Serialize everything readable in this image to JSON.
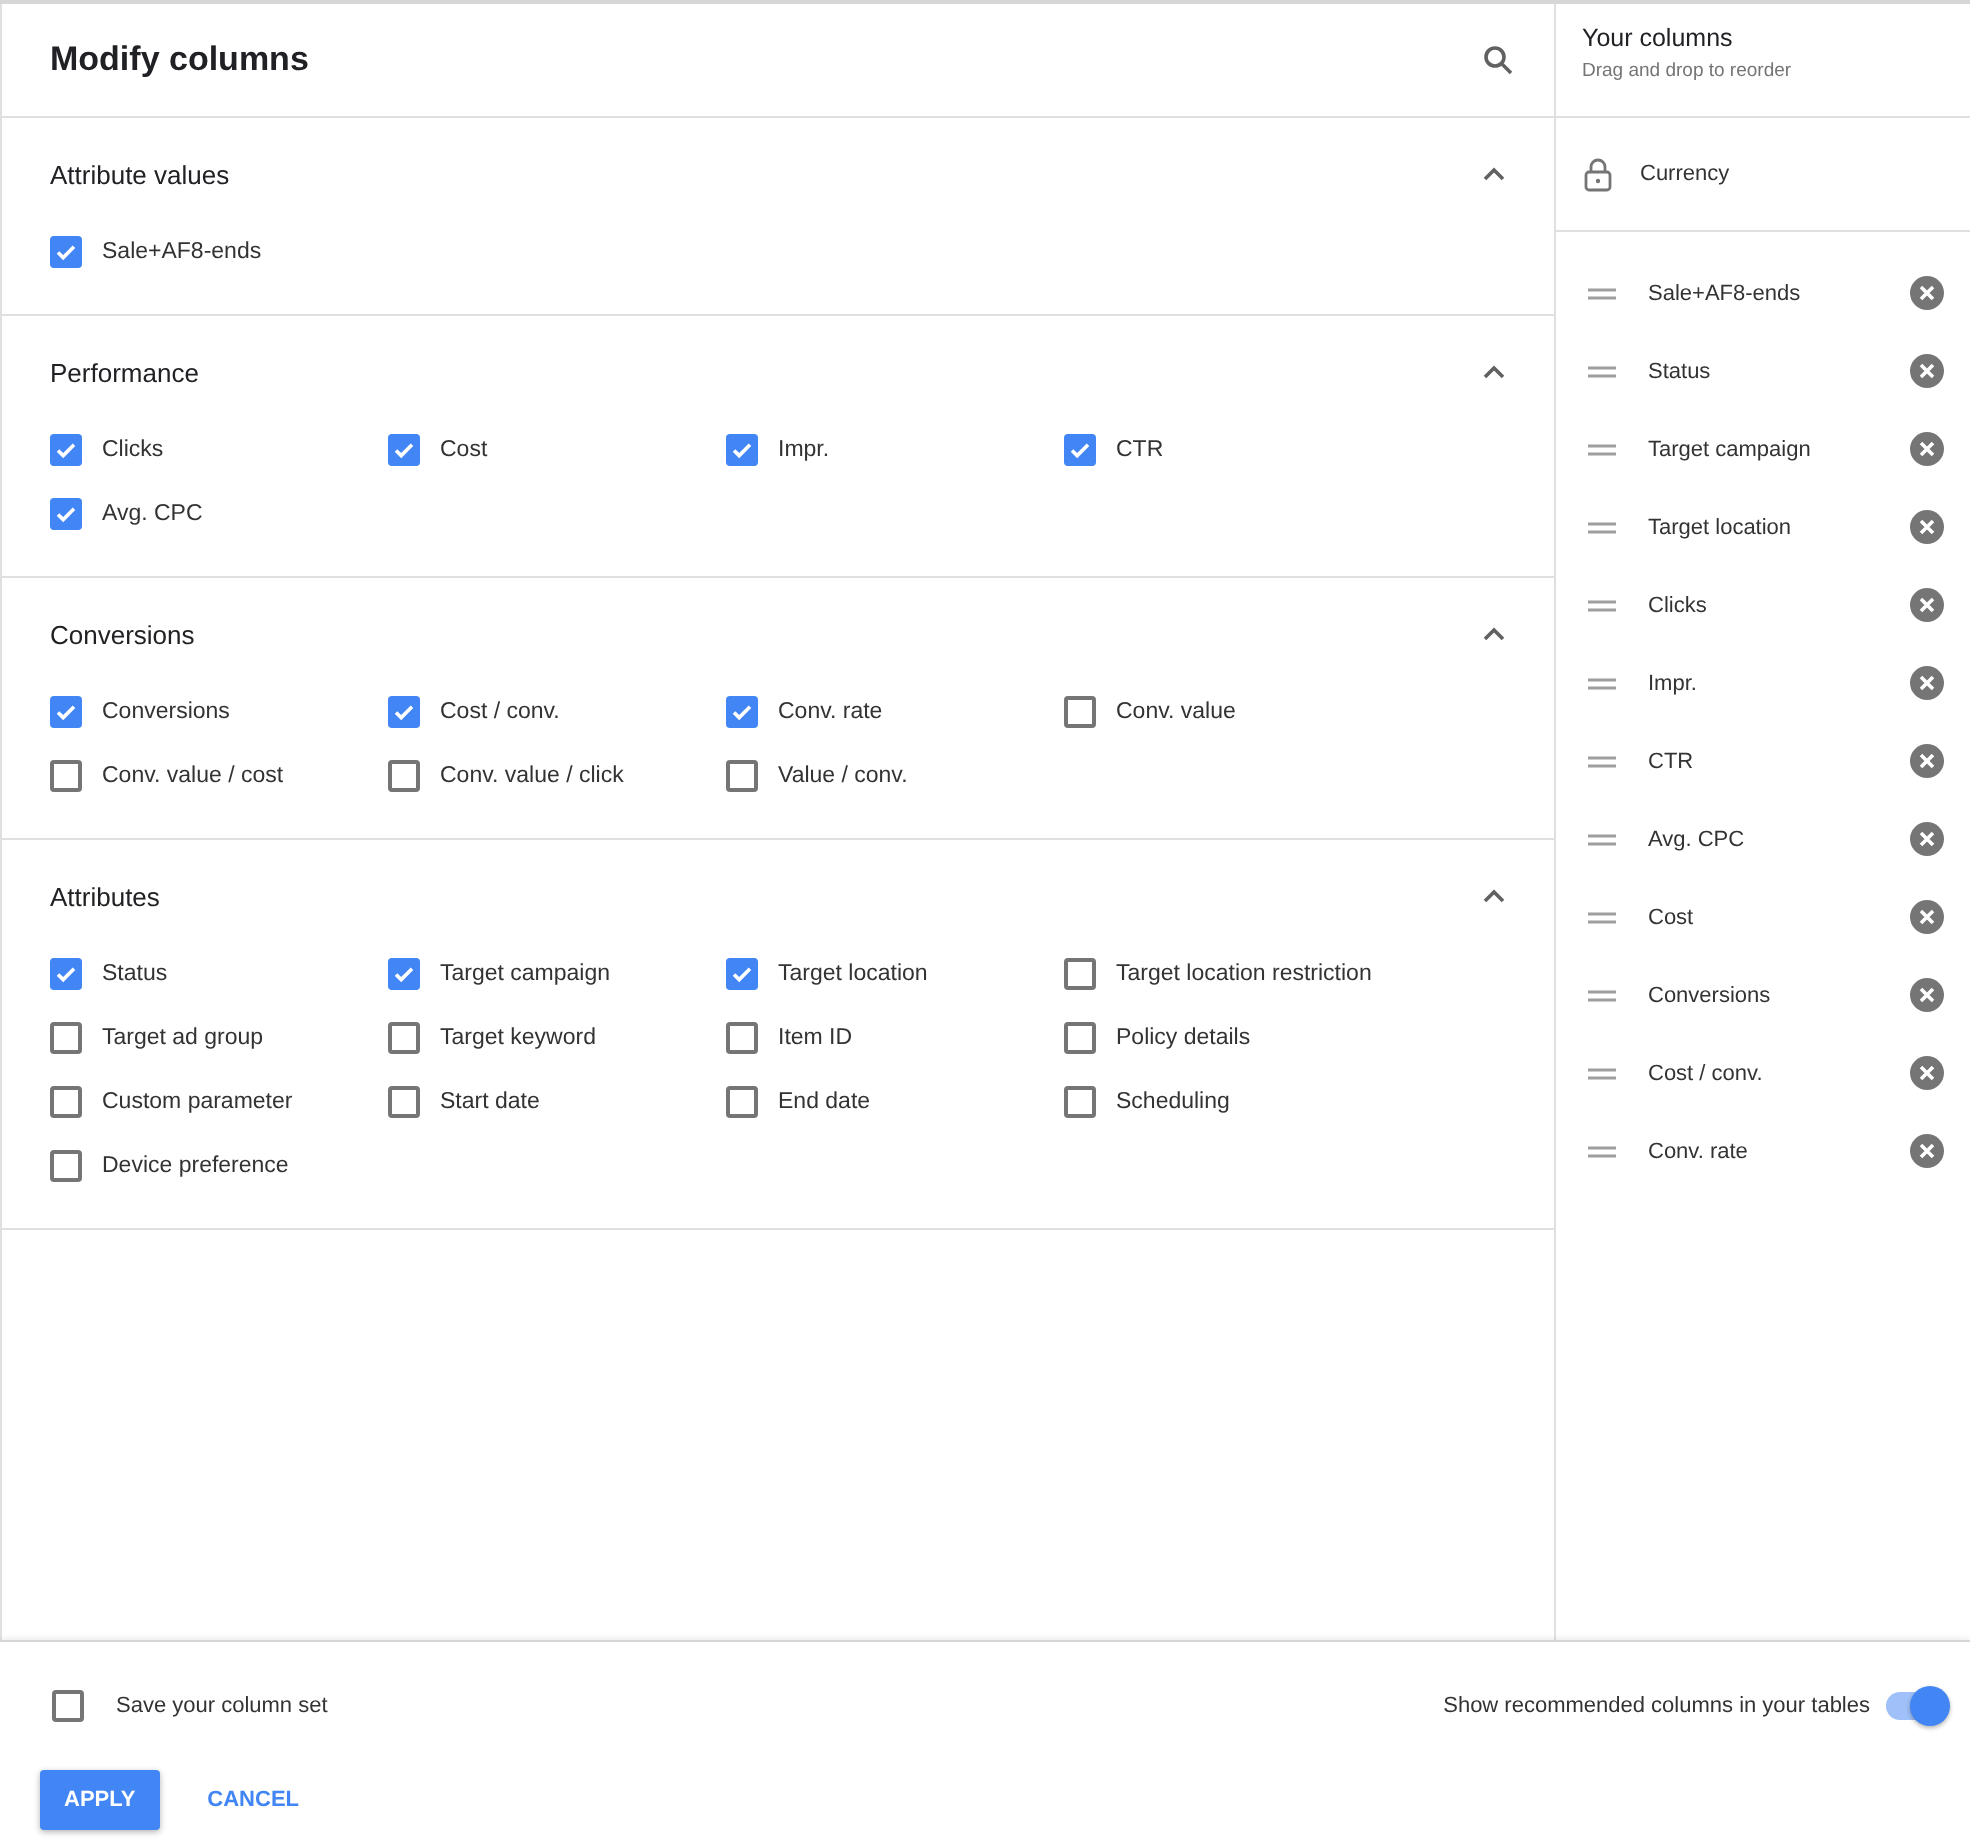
{
  "dialog": {
    "title": "Modify columns"
  },
  "sections": [
    {
      "title": "Attribute values",
      "expanded": true,
      "options": [
        {
          "label": "Sale+AF8-ends",
          "checked": true
        }
      ]
    },
    {
      "title": "Performance",
      "expanded": true,
      "options": [
        {
          "label": "Clicks",
          "checked": true
        },
        {
          "label": "Cost",
          "checked": true
        },
        {
          "label": "Impr.",
          "checked": true
        },
        {
          "label": "CTR",
          "checked": true
        },
        {
          "label": "Avg. CPC",
          "checked": true
        }
      ]
    },
    {
      "title": "Conversions",
      "expanded": true,
      "options": [
        {
          "label": "Conversions",
          "checked": true
        },
        {
          "label": "Cost / conv.",
          "checked": true
        },
        {
          "label": "Conv. rate",
          "checked": true
        },
        {
          "label": "Conv. value",
          "checked": false
        },
        {
          "label": "Conv. value / cost",
          "checked": false
        },
        {
          "label": "Conv. value / click",
          "checked": false
        },
        {
          "label": "Value / conv.",
          "checked": false
        }
      ]
    },
    {
      "title": "Attributes",
      "expanded": true,
      "options": [
        {
          "label": "Status",
          "checked": true
        },
        {
          "label": "Target campaign",
          "checked": true
        },
        {
          "label": "Target location",
          "checked": true
        },
        {
          "label": "Target location restriction",
          "checked": false
        },
        {
          "label": "Target ad group",
          "checked": false
        },
        {
          "label": "Target keyword",
          "checked": false
        },
        {
          "label": "Item ID",
          "checked": false
        },
        {
          "label": "Policy details",
          "checked": false
        },
        {
          "label": "Custom parameter",
          "checked": false
        },
        {
          "label": "Start date",
          "checked": false
        },
        {
          "label": "End date",
          "checked": false
        },
        {
          "label": "Scheduling",
          "checked": false
        },
        {
          "label": "Device preference",
          "checked": false
        }
      ]
    }
  ],
  "your_columns": {
    "title": "Your columns",
    "subtitle": "Drag and drop to reorder",
    "locked": "Currency",
    "items": [
      "Sale+AF8-ends",
      "Status",
      "Target campaign",
      "Target location",
      "Clicks",
      "Impr.",
      "CTR",
      "Avg. CPC",
      "Cost",
      "Conversions",
      "Cost / conv.",
      "Conv. rate"
    ]
  },
  "footer": {
    "save_set": {
      "label": "Save your column set",
      "checked": false
    },
    "recommended": {
      "label": "Show recommended columns in your tables",
      "on": true
    },
    "buttons": [
      "APPLY",
      "CANCEL"
    ]
  }
}
